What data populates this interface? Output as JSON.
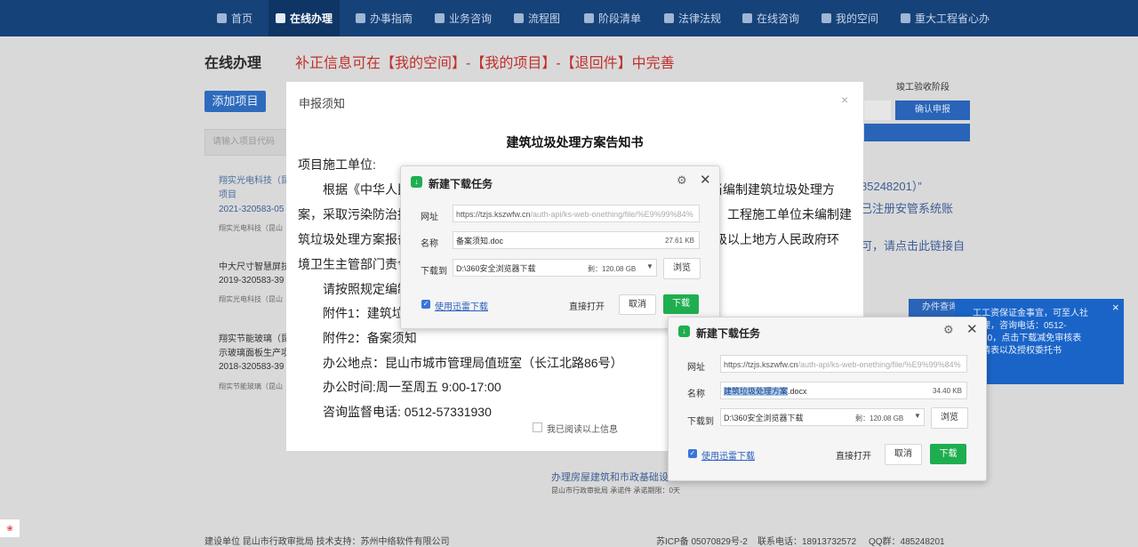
{
  "nav": {
    "items": [
      {
        "label": "首页",
        "icon": "home-icon"
      },
      {
        "label": "在线办理",
        "icon": "monitor-icon"
      },
      {
        "label": "办事指南",
        "icon": "compass-icon"
      },
      {
        "label": "业务咨询",
        "icon": "user-icon"
      },
      {
        "label": "流程图",
        "icon": "flowchart-icon"
      },
      {
        "label": "阶段清单",
        "icon": "checklist-icon"
      },
      {
        "label": "法律法规",
        "icon": "gavel-icon"
      },
      {
        "label": "在线咨询",
        "icon": "chat-icon"
      },
      {
        "label": "我的空间",
        "icon": "gear-icon"
      },
      {
        "label": "重大工程省心办",
        "icon": "flag-icon"
      }
    ]
  },
  "page": {
    "title": "在线办理",
    "notice": "补正信息可在【我的空间】-【我的项目】-【退回件】中完善",
    "add_project": "添加项目",
    "search_placeholder": "请输入项目代码",
    "projects": [
      {
        "name": "翔实光电科技（昆",
        "name2": "项目",
        "code": "2021-320583-05",
        "company": "翔实光电科技（昆山"
      },
      {
        "name": "中大尺寸智慧屏技",
        "code": "2019-320583-39",
        "company": "翔实光电科技（昆山"
      },
      {
        "name": "翔实节能玻璃（昆",
        "name2": "示玻璃面板生产项",
        "code": "2018-320583-39",
        "company": "翔实节能玻璃（昆山"
      }
    ],
    "stage_label": "竣工验收阶段",
    "confirm_button": "确认申报",
    "right_text_1": "85248201）”",
    "right_text_2": "已注册安管系统账",
    "right_text_3": "可，请点击此链接自",
    "side_button": "办件查询",
    "side_panel": {
      "lines": [
        "工工资保证金事宜，可至人社",
        "办理，咨询电话：0512-",
        "4710，点击下载减免审核表",
        "申请表以及授权委托书"
      ],
      "close": "×"
    },
    "bottom_link": "办理房屋建筑和市政基础设",
    "bottom_meta": "昆山市行政审批局   承诺件   承诺期限：0天",
    "footer": {
      "left": "建设单位  昆山市行政审批局  技术支持：苏州中络软件有限公司",
      "icp": "苏ICP备 05070829号-2",
      "phone": "联系电话：18913732572",
      "qq": "QQ群：485248201"
    }
  },
  "modal": {
    "title": "申报须知",
    "close": "×",
    "doc_title": "建筑垃圾处理方案告知书",
    "lines": [
      "项目施工单位:",
      "根据《中华人民",
      "当编制建筑垃圾处理方",
      "案，采取污染防治措",
      "工程施工单位未编制建",
      "筑垃圾处理方案报备",
      "级以上地方人民政府环",
      "境卫生主管部门责令",
      "请按照规定编制",
      "附件1：建筑垃",
      "附件2：备案须知",
      "办公地点：昆山市城市管理局值班室（长江北路86号）",
      "办公时间:周一至周五 9:00-17:00",
      "咨询监督电话: 0512-57331930"
    ],
    "checkbox_label": "我已阅读以上信息"
  },
  "download1": {
    "title": "新建下载任务",
    "url_label": "网址",
    "url_host": "https://tzjs.kszwfw.cn",
    "url_path": "/auth-api/ks-web-onething/file/%E9%99%84%",
    "name_label": "名称",
    "name": "备案须知.doc",
    "size": "27.61 KB",
    "save_label": "下载到",
    "path": "D:\\360安全浏览器下载",
    "free": "剩：120.08 GB",
    "browse": "浏览",
    "xunlei": "使用迅雷下载",
    "open": "直接打开",
    "cancel": "取消",
    "download": "下载"
  },
  "download2": {
    "title": "新建下载任务",
    "url_label": "网址",
    "url_host": "https://tzjs.kszwfw.cn",
    "url_path": "/auth-api/ks-web-onething/file/%E9%99%84%",
    "name_label": "名称",
    "name_selected": "建筑垃圾处理方案",
    "name_ext": ".docx",
    "size": "34.40 KB",
    "save_label": "下载到",
    "path": "D:\\360安全浏览器下载",
    "free": "剩：120.08 GB",
    "browse": "浏览",
    "xunlei": "使用迅雷下载",
    "open": "直接打开",
    "cancel": "取消",
    "download": "下载"
  }
}
